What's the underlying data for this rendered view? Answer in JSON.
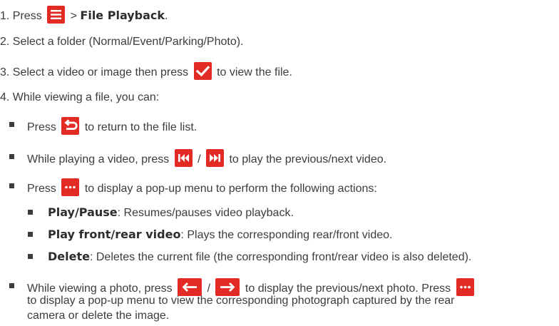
{
  "steps": {
    "s1_num": "1.",
    "s1_a": "Press",
    "s1_b": ">",
    "s1_c": "File Playback",
    "s1_d": ".",
    "s2": "2. Select a folder (Normal/Event/Parking/Photo).",
    "s3_a": "3. Select a video or image then press",
    "s3_b": "to view the file.",
    "s4": "4. While viewing a file, you can:"
  },
  "bullets": {
    "b1_a": "Press",
    "b1_b": "to return to the file list.",
    "b2_a": "While playing a video, press",
    "b2_sep": "/",
    "b2_b": "to play the previous/next video.",
    "b3_a": "Press",
    "b3_b": "to display a pop-up menu to perform the following actions:",
    "sub1_label": "Play/Pause",
    "sub1_text": ": Resumes/pauses video playback.",
    "sub2_label": "Play front/rear video",
    "sub2_text": ": Plays the corresponding rear/front video.",
    "sub3_label": "Delete",
    "sub3_text": ": Deletes the current file (the corresponding front/rear video is also deleted).",
    "b4_a": "While viewing a photo, press",
    "b4_sep": "/",
    "b4_b": "to display the previous/next photo. Press",
    "b4_c": "to display a pop-up menu to view the corresponding photograph captured by the rear",
    "b4_d": "camera or delete the image."
  },
  "icons": {
    "menu": "menu-icon",
    "check": "checkmark-icon",
    "back": "return-icon",
    "prev": "skip-previous-icon",
    "next": "skip-next-icon",
    "more": "more-options-icon",
    "left": "arrow-left-icon",
    "right": "arrow-right-icon"
  },
  "colors": {
    "icon_bg": "#e32b25",
    "text": "#3c3c3c"
  }
}
